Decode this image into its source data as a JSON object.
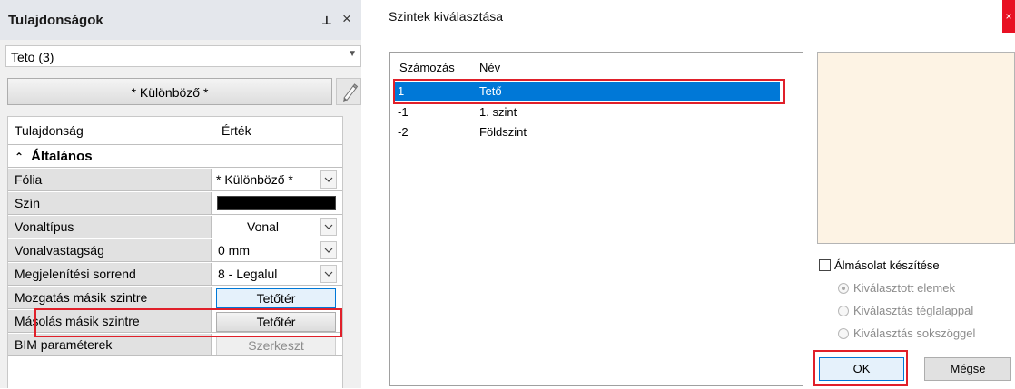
{
  "panel": {
    "title": "Tulajdonságok",
    "close": "×",
    "object_selector": "Teto (3)",
    "multi_button": "* Különböző *",
    "col_property": "Tulajdonság",
    "col_value": "Érték",
    "section": "Általános",
    "rows": [
      {
        "label": "Fólia",
        "value": "* Különböző *"
      },
      {
        "label": "Szín",
        "value": "",
        "color": "#000000"
      },
      {
        "label": "Vonaltípus",
        "value": "Vonal"
      },
      {
        "label": "Vonalvastagság",
        "value": "0 mm"
      },
      {
        "label": "Megjelenítési sorrend",
        "value": "8 - Legalul"
      },
      {
        "label": "Mozgatás másik szintre",
        "value": "Tetőtér"
      },
      {
        "label": "Másolás másik szintre",
        "value": "Tetőtér"
      },
      {
        "label": "BIM paraméterek",
        "value": "Szerkeszt"
      }
    ]
  },
  "dialog": {
    "title": "Szintek kiválasztása",
    "close": "×",
    "col_number": "Számozás",
    "col_name": "Név",
    "levels": [
      {
        "number": "1",
        "name": "Tető",
        "selected": true
      },
      {
        "number": "-1",
        "name": "1. szint",
        "selected": false
      },
      {
        "number": "-2",
        "name": "Földszint",
        "selected": false
      }
    ],
    "mirror_copy": "Álmásolat készítése",
    "options": [
      "Kiválasztott elemek",
      "Kiválasztás téglalappal",
      "Kiválasztás sokszöggel"
    ],
    "ok": "OK",
    "cancel": "Mégse"
  },
  "colors": {
    "selection": "#0078d7",
    "highlight": "#e0202a",
    "preview": "#fdf3e4"
  }
}
